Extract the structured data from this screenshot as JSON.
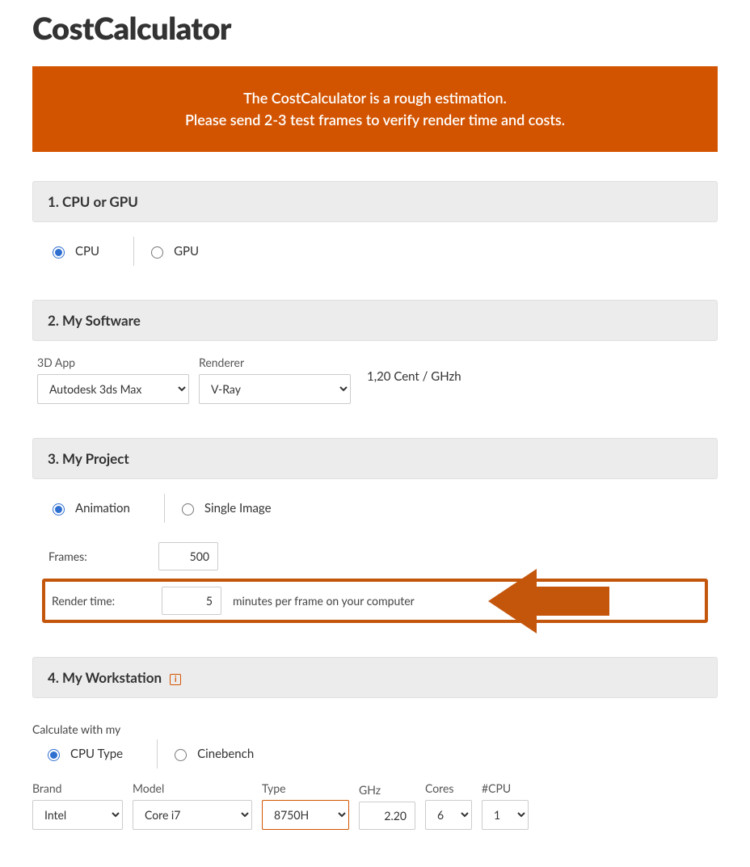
{
  "title": "CostCalculator",
  "banner": {
    "line1": "The CostCalculator is a rough estimation.",
    "line2": "Please send 2-3 test frames to verify render time and costs."
  },
  "section1": {
    "heading": "1. CPU or GPU",
    "opt_cpu": "CPU",
    "opt_gpu": "GPU"
  },
  "section2": {
    "heading": "2. My Software",
    "app_label": "3D App",
    "app_value": "Autodesk 3ds Max",
    "renderer_label": "Renderer",
    "renderer_value": "V-Ray",
    "price": "1,20 Cent / GHzh"
  },
  "section3": {
    "heading": "3. My Project",
    "opt_anim": "Animation",
    "opt_single": "Single Image",
    "frames_label": "Frames:",
    "frames_value": "500",
    "render_label": "Render time:",
    "render_value": "5",
    "render_after": "minutes per frame on your computer"
  },
  "section4": {
    "heading": "4. My Workstation",
    "calc_label": "Calculate with my",
    "opt_cputype": "CPU Type",
    "opt_cinebench": "Cinebench",
    "brand_label": "Brand",
    "brand_value": "Intel",
    "model_label": "Model",
    "model_value": "Core i7",
    "type_label": "Type",
    "type_value": "8750H",
    "ghz_label": "GHz",
    "ghz_value": "2.20",
    "cores_label": "Cores",
    "cores_value": "6",
    "ncpu_label": "#CPU",
    "ncpu_value": "1"
  }
}
